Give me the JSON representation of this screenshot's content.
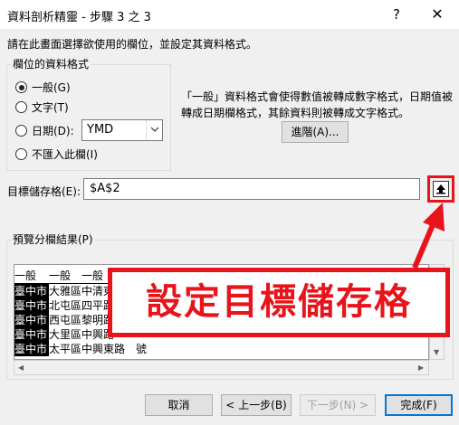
{
  "window": {
    "title": "資料剖析精靈 - 步驟 3 之 3",
    "help": "?",
    "close": "✕"
  },
  "instruction": "請在此畫面選擇欲使用的欄位，並設定其資料格式。",
  "column_format": {
    "legend": "欄位的資料格式",
    "options": [
      "一般(G)",
      "文字(T)",
      "日期(D):",
      "不匯入此欄(I)"
    ],
    "selected": "一般(G)",
    "date_format": "YMD"
  },
  "description": "「一般」資料格式會使得數值被轉成數字格式，日期值被轉成日期欄格式，其餘資料則被轉成文字格式。",
  "advanced_button": "進階(A)...",
  "destination": {
    "label": "目標儲存格(E):",
    "value": "$A$2"
  },
  "preview": {
    "legend": "預覽分欄結果(P)",
    "headers": [
      "一般",
      "一般",
      "一般"
    ],
    "rows": [
      [
        "臺中市",
        "大雅區",
        "中清東"
      ],
      [
        "臺中市",
        "北屯區",
        "四平路"
      ],
      [
        "臺中市",
        "西屯區",
        "黎明路"
      ],
      [
        "臺中市",
        "大里區",
        "中興路"
      ],
      [
        "臺中市",
        "太平區",
        "中興東路"
      ]
    ],
    "last_row_suffix": "號"
  },
  "annotation": {
    "text": "設定目標儲存格",
    "color": "#e8141b"
  },
  "buttons": {
    "cancel": "取消",
    "back": "< 上一步(B)",
    "next": "下一步(N) >",
    "finish": "完成(F)"
  },
  "colors": {
    "annotation_red": "#e8141b",
    "focus_blue": "#0078d7"
  },
  "icons": [
    "collapse-dialog-icon",
    "chevron-down-icon",
    "close-icon",
    "help-icon"
  ]
}
